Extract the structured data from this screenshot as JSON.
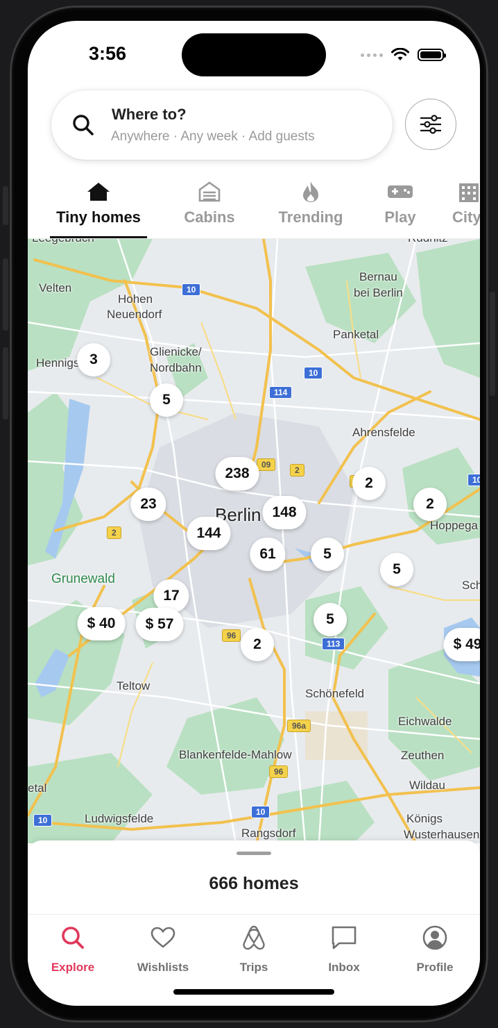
{
  "status_bar": {
    "time": "3:56"
  },
  "search": {
    "title": "Where to?",
    "subtitle": "Anywhere · Any week · Add guests"
  },
  "categories": [
    {
      "label": "Tiny homes",
      "icon": "house-icon",
      "active": true
    },
    {
      "label": "Cabins",
      "icon": "cabin-icon",
      "active": false
    },
    {
      "label": "Trending",
      "icon": "flame-icon",
      "active": false
    },
    {
      "label": "Play",
      "icon": "gamepad-icon",
      "active": false
    },
    {
      "label": "City",
      "icon": "building-icon",
      "active": false
    }
  ],
  "map": {
    "places": [
      "Leegebruch",
      "Velten",
      "Hohen",
      "Neuendorf",
      "Bernau",
      "bei Berlin",
      "Hennigs",
      "Glienicke/",
      "Nordbahn",
      "Panketal",
      "Ahrensfelde",
      "Berlin",
      "Hoppega",
      "Grunewald",
      "Sch",
      "Teltow",
      "Schönefeld",
      "Eichwalde",
      "Zeuthen",
      "Wildau",
      "Blankenfelde-Mahlow",
      "etal",
      "Ludwigsfelde",
      "Rangsdorf",
      "Königs",
      "Wusterhausen",
      "Rüdnitz"
    ],
    "road_shields": [
      "10",
      "10",
      "114",
      "09",
      "2",
      "1",
      "2",
      "10",
      "96",
      "113",
      "96a",
      "96",
      "10",
      "10"
    ],
    "markers": [
      "3",
      "5",
      "238",
      "23",
      "148",
      "144",
      "61",
      "5",
      "2",
      "2",
      "5",
      "17",
      "$ 40",
      "$ 57",
      "2",
      "5",
      "$ 49"
    ]
  },
  "sheet": {
    "count_label": "666 homes"
  },
  "tabs": [
    {
      "label": "Explore",
      "icon": "search-icon",
      "active": true
    },
    {
      "label": "Wishlists",
      "icon": "heart-icon",
      "active": false
    },
    {
      "label": "Trips",
      "icon": "airbnb-logo-icon",
      "active": false
    },
    {
      "label": "Inbox",
      "icon": "message-icon",
      "active": false
    },
    {
      "label": "Profile",
      "icon": "user-circle-icon",
      "active": false
    }
  ],
  "colors": {
    "accent": "#E0385B",
    "text": "#222222",
    "muted": "#717171"
  }
}
